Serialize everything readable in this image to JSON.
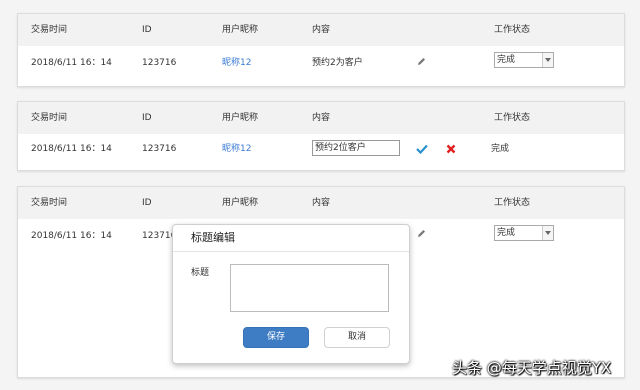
{
  "headers": {
    "time": "交易时间",
    "id": "ID",
    "nickname": "用户昵称",
    "content": "内容",
    "status": "工作状态"
  },
  "row1": {
    "time": "2018/6/11 16：14",
    "id": "123716",
    "nickname": "昵称12",
    "content": "预约2为客户",
    "status": "完成"
  },
  "row2": {
    "time": "2018/6/11 16：14",
    "id": "123716",
    "nickname": "昵称12",
    "content_input": "预约2位客户",
    "status": "完成"
  },
  "row3": {
    "time": "2018/6/11 16：14",
    "id": "123716",
    "status": "完成"
  },
  "dialog": {
    "title": "标题编辑",
    "label": "标题",
    "save": "保存",
    "cancel": "取消"
  },
  "watermark": "头条 @每天学点视觉YX",
  "colors": {
    "link": "#3a7bd5",
    "primary_button": "#3e7cc4",
    "confirm_check": "#2a8fd0",
    "cancel_x": "#e02020"
  },
  "icons": [
    "pencil-icon",
    "check-icon",
    "close-icon",
    "chevron-down-icon"
  ]
}
